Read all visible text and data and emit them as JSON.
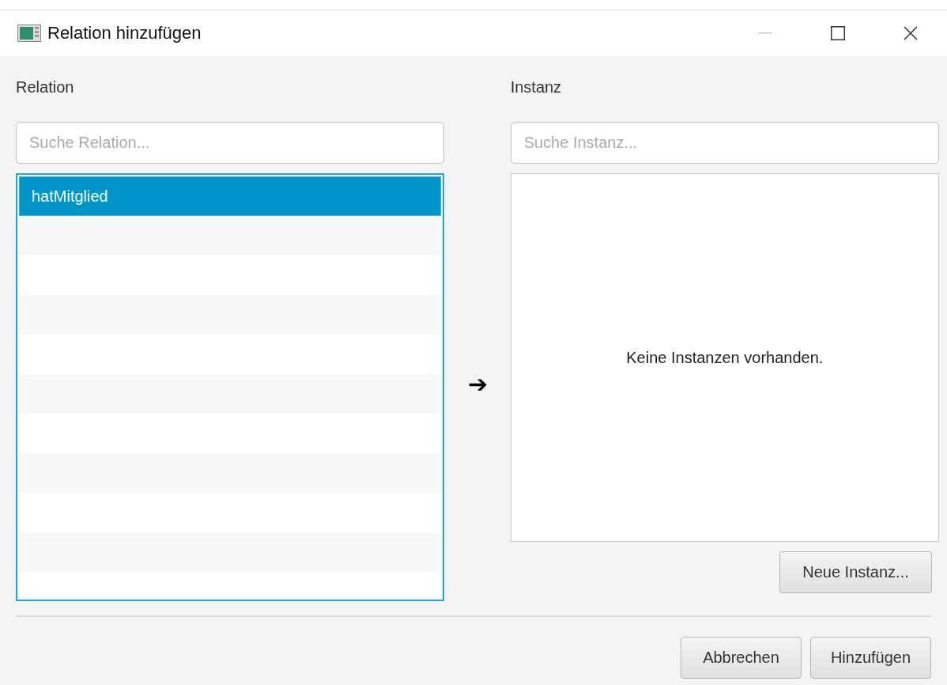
{
  "window": {
    "title": "Relation hinzufügen",
    "minimize_disabled": true
  },
  "relation": {
    "label": "Relation",
    "search": {
      "placeholder": "Suche Relation..."
    },
    "items": [
      {
        "label": "hatMitglied",
        "selected": true
      }
    ]
  },
  "arrow": "➔",
  "instance": {
    "label": "Instanz",
    "search": {
      "placeholder": "Suche Instanz..."
    },
    "empty_message": "Keine Instanzen vorhanden.",
    "new_button": "Neue Instanz..."
  },
  "buttons": [
    "Abbrechen",
    "Hinzufügen"
  ]
}
